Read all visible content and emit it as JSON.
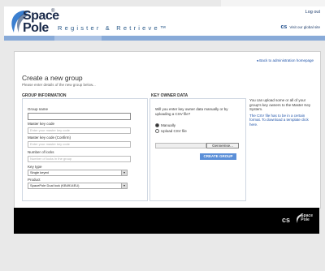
{
  "header": {
    "logo_line1": "Space",
    "logo_reg": "®",
    "logo_line2": "Pole",
    "tagline": "Register & Retrieve™",
    "logout": "Log out",
    "visit_logo": "cs",
    "visit_text": "Visit our global site"
  },
  "main": {
    "back_link": "◂ Back to administration homepage",
    "title": "Create a new group",
    "subtitle": "Please enter details of the new group below..."
  },
  "group_info": {
    "heading": "GROUP INFORMATION",
    "group_name_label": "Group name",
    "group_name_value": "",
    "master_code_label": "Master key code",
    "master_code_placeholder": "Enter your master key code",
    "master_confirm_label": "Master key code (Confirm)",
    "master_confirm_placeholder": "Enter your master key code",
    "locks_label": "Number of locks",
    "locks_placeholder": "Number of locks in the group",
    "key_type_label": "Key type",
    "key_type_value": "Single keyed",
    "product_label": "Product",
    "product_value": "SpacePole Dual lock (KB4914EU)"
  },
  "key_owner": {
    "heading": "KEY OWNER DATA",
    "question": "Will you enter key owner data manually or by uploading a CSV file?",
    "option_manual": "Manually",
    "option_csv": "Upload CSV file",
    "browse_label": "Gennemse...",
    "create_label": "CREATE GROUP"
  },
  "side_info": {
    "p1": "You can upload some or all of your group's key owners to the Master Key System.",
    "p2": "The CSV file has to be in a certain format. To download a template click here."
  },
  "footer": {
    "logo_cs": "cs",
    "logo_sp_line1": "Space",
    "logo_sp_line2": "Pole"
  },
  "colors": {
    "nav_band": "#88aad8",
    "create_button": "#5b8fd8",
    "link": "#2255aa",
    "footer_bg": "#000000"
  }
}
